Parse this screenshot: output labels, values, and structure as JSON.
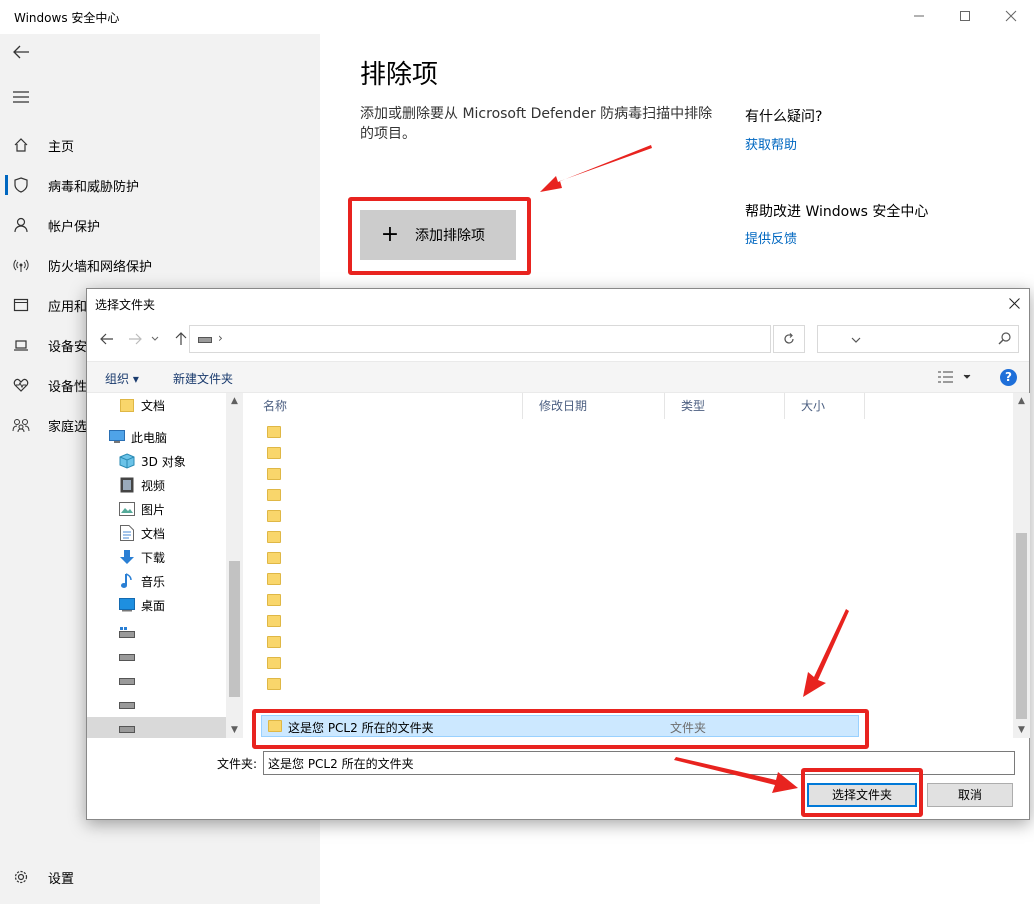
{
  "window": {
    "title": "Windows 安全中心"
  },
  "sidebar": {
    "items": [
      {
        "label": "主页",
        "icon": "home-icon"
      },
      {
        "label": "病毒和威胁防护",
        "icon": "shield-icon"
      },
      {
        "label": "帐户保护",
        "icon": "person-icon"
      },
      {
        "label": "防火墙和网络保护",
        "icon": "wifi-icon"
      },
      {
        "label": "应用和",
        "icon": "app-icon"
      },
      {
        "label": "设备安",
        "icon": "laptop-icon"
      },
      {
        "label": "设备性",
        "icon": "heart-icon"
      },
      {
        "label": "家庭选",
        "icon": "family-icon"
      }
    ],
    "settings_label": "设置"
  },
  "main": {
    "title": "排除项",
    "description": "添加或删除要从 Microsoft Defender 防病毒扫描中排除的项目。",
    "add_button_label": "添加排除项",
    "question_heading": "有什么疑问?",
    "help_link": "获取帮助",
    "improve_heading": "帮助改进 Windows 安全中心",
    "feedback_link": "提供反馈"
  },
  "dialog": {
    "title": "选择文件夹",
    "address_sep": "›",
    "toolbar": {
      "organize": "组织 ▾",
      "new_folder": "新建文件夹"
    },
    "columns": {
      "name": "名称",
      "date": "修改日期",
      "type": "类型",
      "size": "大小"
    },
    "tree": [
      {
        "label": "文档",
        "icon": "folder-icon"
      },
      {
        "label": "此电脑",
        "icon": "computer-icon"
      },
      {
        "label": "3D 对象",
        "icon": "cube-icon"
      },
      {
        "label": "视频",
        "icon": "video-icon"
      },
      {
        "label": "图片",
        "icon": "picture-icon"
      },
      {
        "label": "文档",
        "icon": "document-icon"
      },
      {
        "label": "下载",
        "icon": "download-icon"
      },
      {
        "label": "音乐",
        "icon": "music-icon"
      },
      {
        "label": "桌面",
        "icon": "desktop-icon"
      },
      {
        "label": "",
        "icon": "drive-icon"
      },
      {
        "label": "",
        "icon": "drive-icon"
      },
      {
        "label": "",
        "icon": "drive-icon"
      },
      {
        "label": "",
        "icon": "drive-icon"
      },
      {
        "label": "",
        "icon": "drive-icon"
      }
    ],
    "selected_item": {
      "name": "这是您 PCL2 所在的文件夹",
      "type": "文件夹"
    },
    "folder_label": "文件夹:",
    "folder_value": "这是您 PCL2 所在的文件夹",
    "select_button": "选择文件夹",
    "cancel_button": "取消"
  },
  "colors": {
    "accent": "#0067c0",
    "annotation": "#e8231f",
    "selection": "#cce8ff"
  }
}
